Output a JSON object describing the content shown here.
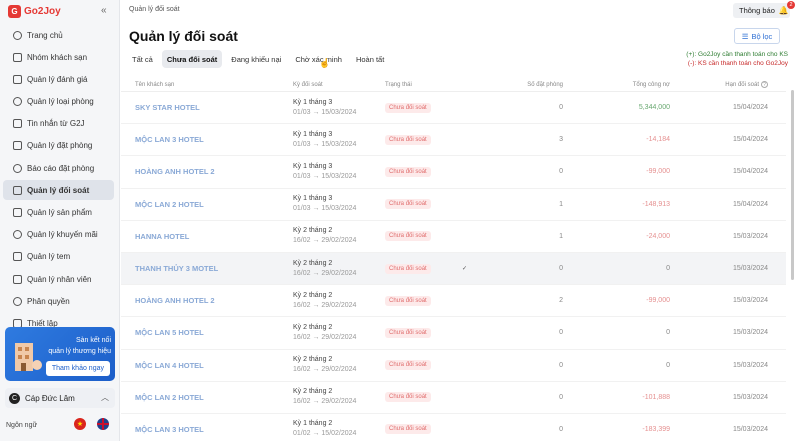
{
  "app": {
    "logo_mark": "G",
    "logo_text": "Go2Joy",
    "collapse_icon": "«"
  },
  "sidebar": {
    "items": [
      {
        "label": "Trang chủ",
        "icon": "home-icon"
      },
      {
        "label": "Nhóm khách sạn",
        "icon": "hotel-group-icon"
      },
      {
        "label": "Quản lý đánh giá",
        "icon": "star-icon"
      },
      {
        "label": "Quản lý loại phòng",
        "icon": "room-type-icon"
      },
      {
        "label": "Tin nhắn từ G2J",
        "icon": "message-icon"
      },
      {
        "label": "Quản lý đặt phòng",
        "icon": "booking-icon"
      },
      {
        "label": "Báo cáo đặt phòng",
        "icon": "chart-icon"
      },
      {
        "label": "Quản lý đối soát",
        "icon": "reconcile-icon",
        "active": true
      },
      {
        "label": "Quản lý sản phẩm",
        "icon": "product-icon"
      },
      {
        "label": "Quản lý khuyến mãi",
        "icon": "tag-icon"
      },
      {
        "label": "Quản lý tem",
        "icon": "stamp-icon"
      },
      {
        "label": "Quản lý nhân viên",
        "icon": "staff-icon"
      },
      {
        "label": "Phân quyền",
        "icon": "shield-icon"
      },
      {
        "label": "Thiết lập",
        "icon": "settings-icon"
      }
    ],
    "promo": {
      "line1": "Sàn kết nối",
      "line2": "quản lý thương hiệu",
      "button": "Tham khảo ngay"
    },
    "user": {
      "initial": "C",
      "name": "Cáp Đức Lâm"
    },
    "language_label": "Ngôn ngữ"
  },
  "header": {
    "breadcrumb": "Quản lý đối soát",
    "notify_label": "Thông báo",
    "notify_count": "2",
    "title": "Quản lý đối soát",
    "filter_label": "Bộ lọc"
  },
  "tabs": [
    "Tất cả",
    "Chưa đối soát",
    "Đang khiếu nại",
    "Chờ xác minh",
    "Hoàn tất"
  ],
  "legend": {
    "plus": "(+): Go2Joy cần thanh toán cho KS",
    "minus": "(-): KS cần thanh toán cho Go2Joy"
  },
  "table": {
    "headers": [
      "Tên khách sạn",
      "Kỳ đối soát",
      "Trạng thái",
      "Số đặt phòng",
      "Tổng công nợ",
      "Hạn đối soát"
    ],
    "rows": [
      {
        "name": "SKY STAR HOTEL",
        "period": "Kỳ 1 tháng 3",
        "range": "01/03 → 15/03/2024",
        "status": "Chưa đối soát",
        "rooms": "0",
        "debt": "5,344,000",
        "sign": "pos",
        "deadline": "15/04/2024"
      },
      {
        "name": "MỘC LAN 3 HOTEL",
        "period": "Kỳ 1 tháng 3",
        "range": "01/03 → 15/03/2024",
        "status": "Chưa đối soát",
        "rooms": "3",
        "debt": "-14,184",
        "sign": "neg",
        "deadline": "15/04/2024"
      },
      {
        "name": "HOÀNG ANH HOTEL 2",
        "period": "Kỳ 1 tháng 3",
        "range": "01/03 → 15/03/2024",
        "status": "Chưa đối soát",
        "rooms": "0",
        "debt": "-99,000",
        "sign": "neg",
        "deadline": "15/04/2024"
      },
      {
        "name": "MỘC LAN 2 HOTEL",
        "period": "Kỳ 1 tháng 3",
        "range": "01/03 → 15/03/2024",
        "status": "Chưa đối soát",
        "rooms": "1",
        "debt": "-148,913",
        "sign": "neg",
        "deadline": "15/04/2024"
      },
      {
        "name": "HANNA HOTEL",
        "period": "Kỳ 2 tháng 2",
        "range": "16/02 → 29/02/2024",
        "status": "Chưa đối soát",
        "rooms": "1",
        "debt": "-24,000",
        "sign": "neg",
        "deadline": "15/03/2024"
      },
      {
        "name": "THANH THỦY 3 MOTEL",
        "period": "Kỳ 2 tháng 2",
        "range": "16/02 → 29/02/2024",
        "status": "Chưa đối soát",
        "rooms": "0",
        "debt": "0",
        "sign": "zero",
        "deadline": "15/03/2024",
        "highlight": true
      },
      {
        "name": "HOÀNG ANH HOTEL 2",
        "period": "Kỳ 2 tháng 2",
        "range": "16/02 → 29/02/2024",
        "status": "Chưa đối soát",
        "rooms": "2",
        "debt": "-99,000",
        "sign": "neg",
        "deadline": "15/03/2024"
      },
      {
        "name": "MỘC LAN 5 HOTEL",
        "period": "Kỳ 2 tháng 2",
        "range": "16/02 → 29/02/2024",
        "status": "Chưa đối soát",
        "rooms": "0",
        "debt": "0",
        "sign": "zero",
        "deadline": "15/03/2024"
      },
      {
        "name": "MỘC LAN 4 HOTEL",
        "period": "Kỳ 2 tháng 2",
        "range": "16/02 → 29/02/2024",
        "status": "Chưa đối soát",
        "rooms": "0",
        "debt": "0",
        "sign": "zero",
        "deadline": "15/03/2024"
      },
      {
        "name": "MỘC LAN 2 HOTEL",
        "period": "Kỳ 2 tháng 2",
        "range": "16/02 → 29/02/2024",
        "status": "Chưa đối soát",
        "rooms": "0",
        "debt": "-101,888",
        "sign": "neg",
        "deadline": "15/03/2024"
      },
      {
        "name": "MỘC LAN 3 HOTEL",
        "period": "Kỳ 1 tháng 2",
        "range": "01/02 → 15/02/2024",
        "status": "Chưa đối soát",
        "rooms": "0",
        "debt": "-183,399",
        "sign": "neg",
        "deadline": "15/03/2024"
      }
    ]
  }
}
